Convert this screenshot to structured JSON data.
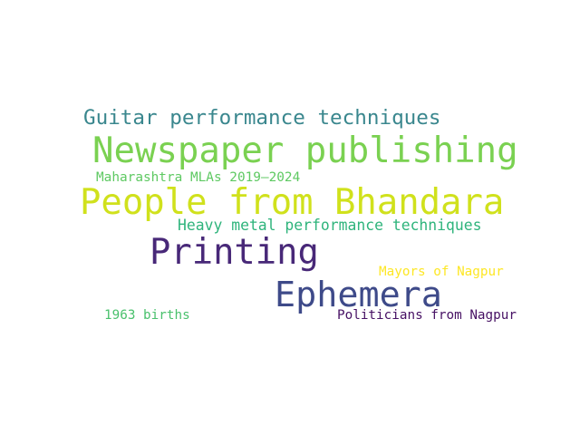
{
  "words": [
    {
      "text": "Guitar performance techniques",
      "color": "#3a878e"
    },
    {
      "text": "Newspaper publishing",
      "color": "#7ad151"
    },
    {
      "text": "Maharashtra MLAs 2019–2024",
      "color": "#5ec962"
    },
    {
      "text": "People from Bhandara",
      "color": "#d0e11c"
    },
    {
      "text": "Heavy metal performance techniques",
      "color": "#2fb47c"
    },
    {
      "text": "Printing",
      "color": "#482878"
    },
    {
      "text": "Mayors of Nagpur",
      "color": "#fde725"
    },
    {
      "text": "Ephemera",
      "color": "#3e4a89"
    },
    {
      "text": "1963 births",
      "color": "#4ac16d"
    },
    {
      "text": "Politicians from Nagpur",
      "color": "#471164"
    }
  ]
}
